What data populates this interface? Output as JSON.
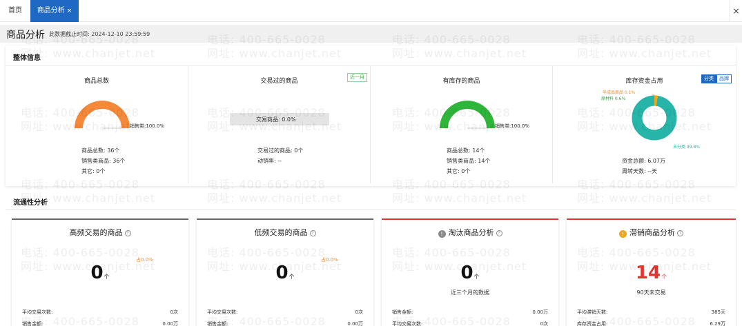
{
  "tabs": {
    "home": "首页",
    "active": "商品分析",
    "active_close": "×",
    "close_all": "×"
  },
  "header": {
    "title": "商品分析",
    "subtitle": "此数据截止时间: 2024-12-10 23:59:59"
  },
  "overall": {
    "title": "整体信息",
    "cards": {
      "total": {
        "title": "商品总数",
        "gauge_label": "销售类:100.0%",
        "gauge_fraction": 1.0,
        "gauge_color": "#f5893a",
        "lines": [
          "商品总数: 36个",
          "销售类商品: 36个",
          "其它: 0个"
        ]
      },
      "traded": {
        "title": "交易过的商品",
        "badge": "近一月",
        "bar_label": "交易商品: 0.0%",
        "lines": [
          "交易过的商品: 0个",
          "动销率: --"
        ]
      },
      "stock": {
        "title": "有库存的商品",
        "gauge_label": "销售类:100.0%",
        "gauge_fraction": 1.0,
        "gauge_color": "#2fb53a",
        "lines": [
          "商品总数: 14个",
          "销售类商品: 14个",
          "其它: 0个"
        ]
      },
      "capital": {
        "title": "库存资金占用",
        "seg_on": "分类",
        "seg_off": "品牌",
        "slices": [
          {
            "label": "未分类 99.8%",
            "value": 99.8,
            "color": "#26b5a8"
          },
          {
            "label": "原材料 0.6%",
            "value": 0.6,
            "color": "#3aa24a"
          },
          {
            "label": "半成品商品 0.1%",
            "value": 0.1,
            "color": "#f08a30"
          }
        ],
        "lines": [
          "资金总额: 6.07万",
          "周转天数: --天"
        ]
      }
    }
  },
  "flow": {
    "title": "流通性分析",
    "cards": {
      "high": {
        "title": "高频交易的商品",
        "ratio": "占0.0%",
        "value": "0",
        "unit": "个",
        "bar_color": "#666666",
        "rows": [
          {
            "k": "平均交易次数:",
            "v": "0次"
          },
          {
            "k": "销售金额:",
            "v": "0.00万"
          }
        ]
      },
      "low": {
        "title": "低频交易的商品",
        "ratio": "占0.0%",
        "value": "0",
        "unit": "个",
        "bar_color": "#666666",
        "rows": [
          {
            "k": "平均交易次数:",
            "v": "0次"
          },
          {
            "k": "销售金额:",
            "v": "0.00万"
          }
        ]
      },
      "eliminate": {
        "title": "淘汰商品分析",
        "value": "0",
        "unit": "个",
        "note": "近三个月的数据",
        "bar_color": "#e0362f",
        "icon_color": "#8a8a8a",
        "rows": [
          {
            "k": "销售金额:",
            "v": "0.00万"
          },
          {
            "k": "平均交易次数:",
            "v": "0次"
          }
        ]
      },
      "slow": {
        "title": "滞销商品分析",
        "value": "14",
        "unit": "个",
        "note": "90天未交易",
        "bar_color": "#e0362f",
        "icon_color": "#f2a615",
        "rows": [
          {
            "k": "平均滞销天数:",
            "v": "385天"
          },
          {
            "k": "库存资金占用:",
            "v": "6.29万"
          }
        ]
      }
    }
  },
  "watermark": {
    "phone": "电话: 400-665-0028",
    "site": "网址: www.chanjet.net"
  }
}
